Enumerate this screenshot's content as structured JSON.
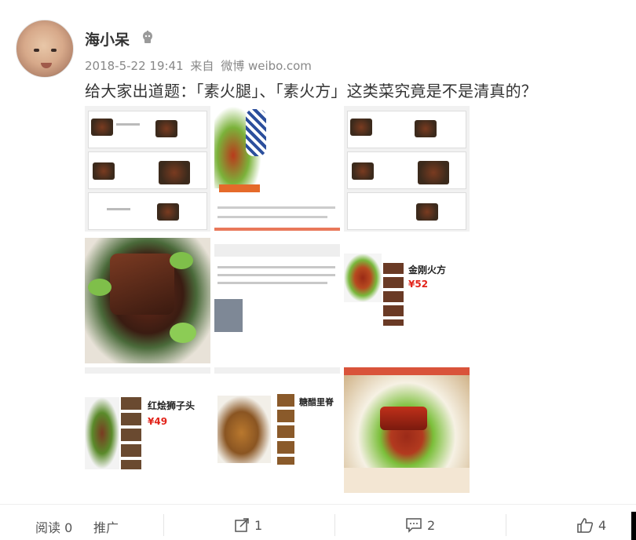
{
  "post": {
    "username": "海小呆",
    "date": "2018-5-22 19:41",
    "source_prefix": "来自",
    "source": "微博 weibo.com",
    "text": "给大家出道题：「素火腿」、「素火方」这类菜究竟是不是清真的？"
  },
  "images": {
    "tile1": {
      "label": "",
      "row_labels": [
        "",
        ""
      ]
    },
    "tile6": {
      "dish": "金刚火方",
      "price": "¥52"
    },
    "tile7": {
      "dish": "红烩狮子头",
      "price": "¥49"
    },
    "tile8": {
      "dish": "糖醋里脊"
    }
  },
  "footer": {
    "read_label": "阅读",
    "read_count": "0",
    "promote_label": "推广",
    "share_count": "1",
    "comment_count": "2",
    "like_count": "4"
  },
  "colors": {
    "price_red": "#e2231a",
    "text": "#333333",
    "muted": "#888888"
  }
}
